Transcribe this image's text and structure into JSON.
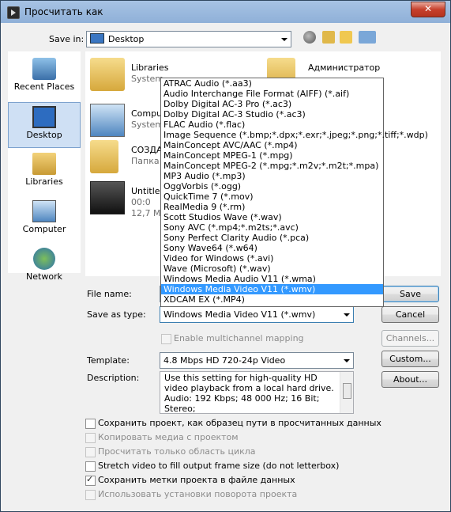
{
  "window": {
    "title": "Просчитать как",
    "close_glyph": "✕"
  },
  "save_in": {
    "label": "Save in:",
    "value": "Desktop"
  },
  "places": [
    {
      "label": "Recent Places",
      "icon": "recent-places-icon"
    },
    {
      "label": "Desktop",
      "icon": "desktop-icon",
      "selected": true
    },
    {
      "label": "Libraries",
      "icon": "libraries-icon"
    },
    {
      "label": "Computer",
      "icon": "computer-icon"
    },
    {
      "label": "Network",
      "icon": "network-icon"
    }
  ],
  "files": [
    {
      "name": "Libraries",
      "sub": "System"
    },
    {
      "name": "Администратор",
      "sub": ""
    },
    {
      "name": "Compu",
      "sub": "System"
    },
    {
      "name": "СОЗДА",
      "sub": "Папка"
    },
    {
      "name": "Untitle",
      "sub": "00:0",
      "sub2": "12,7 M"
    }
  ],
  "file_name": {
    "label": "File name:",
    "value": ""
  },
  "save_as_type": {
    "label": "Save as type:",
    "value": "Windows Media Video V11 (*.wmv)",
    "options": [
      "ATRAC Audio (*.aa3)",
      "Audio Interchange File Format (AIFF) (*.aif)",
      "Dolby Digital AC-3 Pro (*.ac3)",
      "Dolby Digital AC-3 Studio (*.ac3)",
      "FLAC Audio (*.flac)",
      "Image Sequence (*.bmp;*.dpx;*.exr;*.jpeg;*.png;*.tiff;*.wdp)",
      "MainConcept AVC/AAC (*.mp4)",
      "MainConcept MPEG-1 (*.mpg)",
      "MainConcept MPEG-2 (*.mpg;*.m2v;*.m2t;*.mpa)",
      "MP3 Audio (*.mp3)",
      "OggVorbis (*.ogg)",
      "QuickTime 7 (*.mov)",
      "RealMedia 9 (*.rm)",
      "Scott Studios Wave (*.wav)",
      "Sony AVC (*.mp4;*.m2ts;*.avc)",
      "Sony Perfect Clarity Audio (*.pca)",
      "Sony Wave64 (*.w64)",
      "Video for Windows (*.avi)",
      "Wave (Microsoft) (*.wav)",
      "Windows Media Audio V11 (*.wma)",
      "Windows Media Video V11 (*.wmv)",
      "XDCAM EX (*.MP4)"
    ],
    "selected_index": 20
  },
  "multichannel": {
    "label": "Enable multichannel mapping"
  },
  "template": {
    "label": "Template:",
    "value": "4.8 Mbps HD 720-24p Video"
  },
  "description": {
    "label": "Description:",
    "text": "Use this setting for high-quality HD video playback from a local hard drive. Audio: 192 Kbps; 48 000 Hz; 16 Bit; Stereo;"
  },
  "buttons": {
    "save": "Save",
    "cancel": "Cancel",
    "channels": "Channels...",
    "custom": "Custom...",
    "about": "About..."
  },
  "checkboxes": [
    {
      "label": "Сохранить проект, как образец пути в просчитанных данных",
      "checked": false,
      "enabled": true
    },
    {
      "label": "Копировать медиа с проектом",
      "checked": false,
      "enabled": false
    },
    {
      "label": "Просчитать только область цикла",
      "checked": false,
      "enabled": false
    },
    {
      "label": "Stretch video to fill output frame size (do not letterbox)",
      "checked": false,
      "enabled": true
    },
    {
      "label": "Сохранить метки проекта в файле данных",
      "checked": true,
      "enabled": true
    },
    {
      "label": "Использовать установки поворота проекта",
      "checked": false,
      "enabled": false
    }
  ]
}
